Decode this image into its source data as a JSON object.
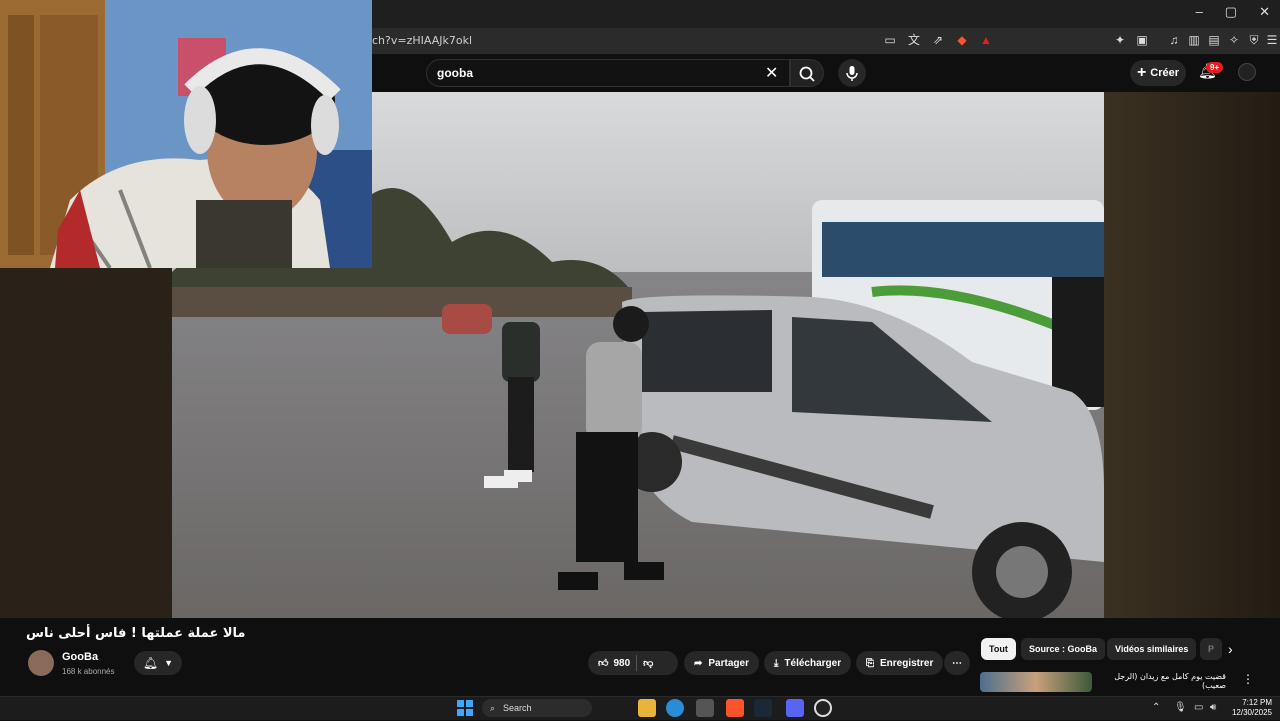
{
  "browser": {
    "url_fragment": "ch?v=zHIAAJk7okl",
    "window_controls": [
      "–",
      "▢",
      "✕"
    ]
  },
  "youtube": {
    "search_value": "gooba",
    "create_label": "Créer",
    "notifications": "9+"
  },
  "video": {
    "title": "مالا عملة عملتها ! فاس أحلى ناس",
    "channel": "GooBa",
    "subscribers": "168 k abonnés",
    "likes": "980"
  },
  "actions": {
    "share": "Partager",
    "download": "Télécharger",
    "save": "Enregistrer",
    "more": "⋯"
  },
  "chips": [
    "Tout",
    "Source : GooBa",
    "Vidéos similaires",
    "P"
  ],
  "recommendation": {
    "title": "قضيت يوم كامل مع زيدان (الرجل صعيب)"
  },
  "taskbar": {
    "search_label": "Search",
    "time": "7:12 PM",
    "date": "12/30/2025"
  },
  "colors": {
    "yt_bg": "#0f0f0f",
    "pill_bg": "#272727",
    "badge_red": "#e41e1e"
  }
}
